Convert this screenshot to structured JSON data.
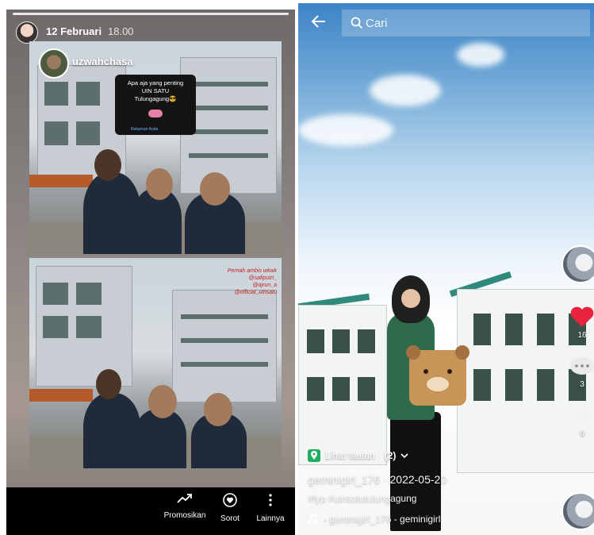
{
  "story": {
    "date": "12 Februari",
    "time": "18.00",
    "account": "uzwahchasa",
    "sticker_text": "Apa aja yang penting\nUIN SATU\nTulungagung😎",
    "sticker_footer": "Rekaman Anda",
    "mentions": "Pernah ambis wkwk\n@safiputri_\n@ajrun_a\n@official_uinsatu",
    "actions": [
      {
        "label": "Promosikan",
        "icon": "trend-arrow-icon"
      },
      {
        "label": "Sorot",
        "icon": "heart-circle-icon"
      },
      {
        "label": "Lainnya",
        "icon": "more-vertical-icon"
      }
    ]
  },
  "video": {
    "search_placeholder": "Cari",
    "like_count": "16",
    "comment_count": "3",
    "share_count": "0",
    "link_label": "Lihat tautan",
    "link_count": "(2)",
    "creator": "geminigirl_176 · 2022-05-20",
    "hashtags": "#fyp #uinsatutulungagung",
    "music": "- geminigirl_176 - geminigirl",
    "colors": {
      "like": "#e8243c",
      "link_pin": "#1fae62"
    }
  }
}
